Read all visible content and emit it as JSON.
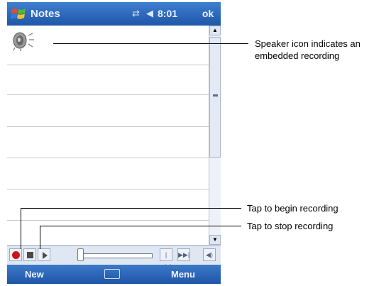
{
  "titlebar": {
    "app_title": "Notes",
    "clock": "8:01",
    "ok_label": "ok",
    "icons": [
      "windows-flag-icon",
      "connectivity-icon",
      "volume-icon"
    ]
  },
  "note": {
    "embedded_item": "speaker-icon"
  },
  "recording_toolbar": {
    "buttons": [
      "record-button",
      "stop-button",
      "play-button",
      "position-slider",
      "skip-back-button",
      "skip-forward-button",
      "volume-button"
    ]
  },
  "menubar": {
    "left_label": "New",
    "right_label": "Menu",
    "center_icon": "keyboard-icon"
  },
  "callouts": {
    "speaker": "Speaker icon indicates an embedded recording",
    "record": "Tap to begin recording",
    "stop": "Tap to stop recording"
  },
  "colors": {
    "titlebar": "#2a63b8",
    "record_dot": "#c81414",
    "toolbar_bg": "#dfe7f3"
  }
}
